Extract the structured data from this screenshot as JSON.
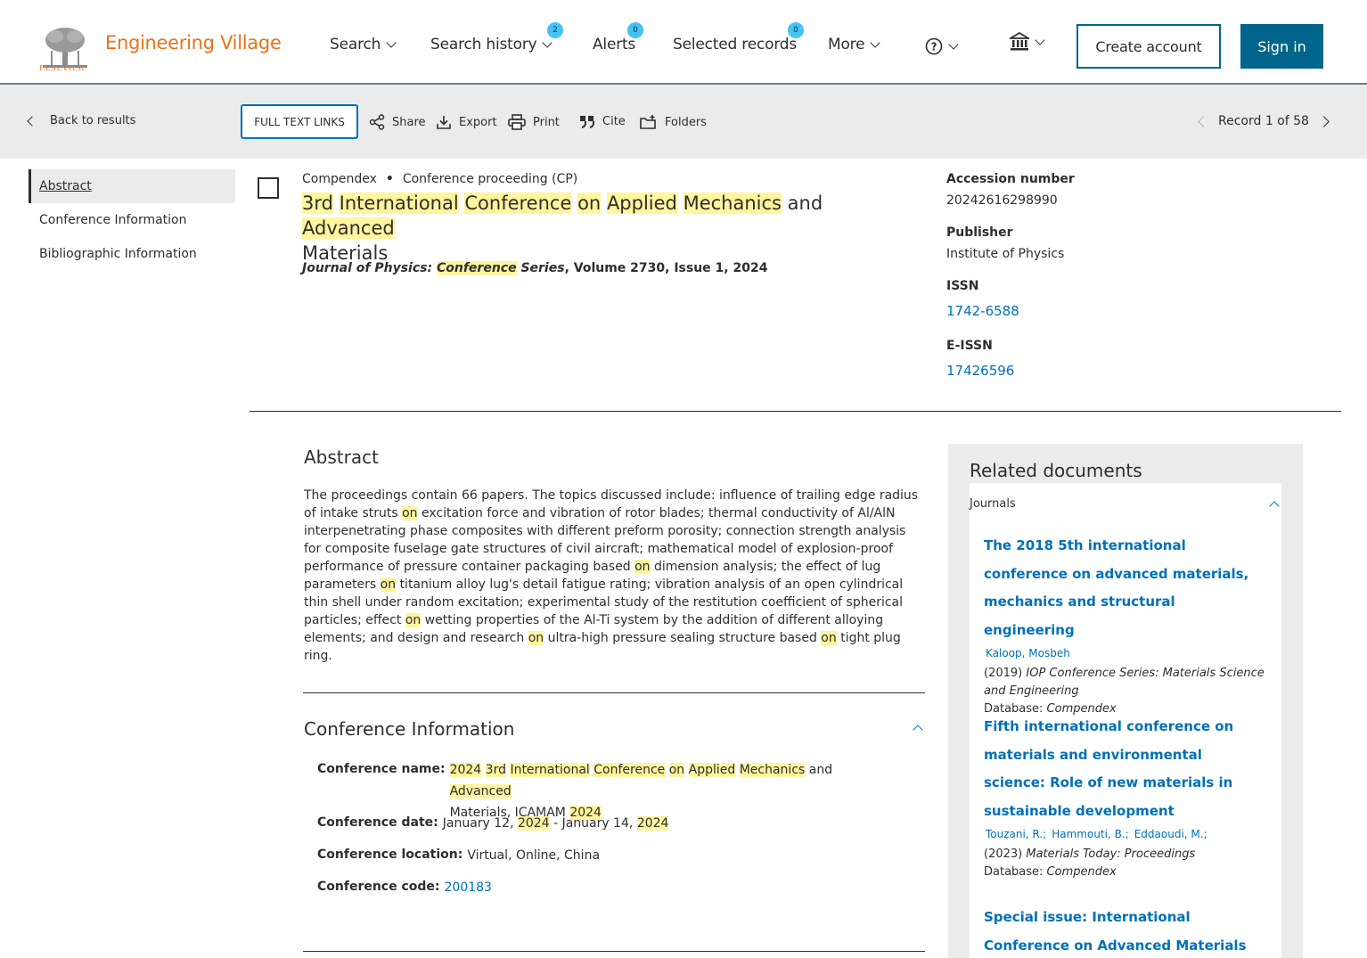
{
  "header": {
    "logo_text": "ELSEVIER",
    "brand": "Engineering Village",
    "nav": {
      "search": "Search",
      "search_history": "Search history",
      "search_history_count": "2",
      "alerts": "Alerts",
      "alerts_count": "0",
      "selected_records": "Selected records",
      "selected_records_count": "0",
      "more": "More"
    },
    "create_account": "Create account",
    "sign_in": "Sign in"
  },
  "toolbar": {
    "back": "Back to results",
    "full_text": "FULL TEXT LINKS",
    "share": "Share",
    "export": "Export",
    "print": "Print",
    "cite": "Cite",
    "folders": "Folders",
    "record_nav": "Record 1 of 58"
  },
  "sidebar": {
    "items": [
      {
        "label": "Abstract"
      },
      {
        "label": "Conference Information"
      },
      {
        "label": "Bibliographic Information"
      }
    ]
  },
  "record": {
    "database": "Compendex",
    "separator": "•",
    "doc_type": "Conference proceeding (CP)",
    "title_words": [
      "3rd",
      "International",
      "Conference",
      "on",
      "Applied",
      "Mechanics",
      "and",
      "Advanced",
      "Materials"
    ],
    "journal_prefix": "Journal of Physics: ",
    "journal_hl": "Conference",
    "journal_suffix": " Series",
    "volume_info": ", Volume 2730, Issue 1, 2024"
  },
  "info": {
    "accession_label": "Accession number",
    "accession_value": "20242616298990",
    "publisher_label": "Publisher",
    "publisher_value": "Institute of Physics",
    "issn_label": "ISSN",
    "issn_value": "1742-6588",
    "eissn_label": "E-ISSN",
    "eissn_value": "17426596"
  },
  "abstract": {
    "heading": "Abstract",
    "parts": [
      "The proceedings contain 66 papers. The topics discussed include: influence of trailing edge radius of intake struts ",
      "on",
      " excitation force and vibration of rotor blades; thermal conductivity of Al/AlN interpenetrating phase composites with different preform porosity; connection strength analysis for composite fuselage gate structures of civil aircraft; mathematical model of explosion-proof performance of pressure container packaging based ",
      "on",
      " dimension analysis; the effect of lug parameters ",
      "on",
      " titanium alloy lug's detail fatigue rating; vibration analysis of an open cylindrical thin shell under random excitation; experimental study of the restitution coefficient of spherical particles; effect ",
      "on",
      " wetting properties of the Al-Ti system by the addition of different alloying elements; and design and research ",
      "on",
      " ultra-high pressure sealing structure based ",
      "on",
      " tight plug ring."
    ]
  },
  "conference": {
    "heading": "Conference Information",
    "name_label": "Conference name:",
    "name_words": [
      "2024",
      "3rd",
      "International",
      "Conference",
      "on",
      "Applied",
      "Mechanics",
      "and",
      "Advanced",
      "Materials, ICAMAM",
      "2024"
    ],
    "date_label": "Conference date:",
    "date_parts": [
      "January 12, ",
      "2024",
      " - January 14, ",
      "2024"
    ],
    "location_label": "Conference location:",
    "location_value": "Virtual, Online, China",
    "code_label": "Conference code:",
    "code_value": "200183"
  },
  "related": {
    "heading": "Related documents",
    "group": "Journals",
    "items": [
      {
        "title": "The 2018 5th international conference on advanced materials, mechanics and structural engineering",
        "authors": [
          "Kaloop, Mosbeh"
        ],
        "year": "(2019)",
        "source": "IOP Conference Series: Materials Science and Engineering",
        "db_label": "Database: ",
        "db": "Compendex"
      },
      {
        "title": "Fifth international conference on materials and environmental science: Role of new materials in sustainable development",
        "authors": [
          "Touzani, R.;",
          "Hammouti, B.;",
          "Eddaoudi, M.;"
        ],
        "year": "(2023)",
        "source": "Materials Today: Proceedings",
        "db_label": "Database: ",
        "db": "Compendex"
      },
      {
        "title": "Special issue: International Conference on Advanced Materials and Mechanical"
      }
    ]
  },
  "colors": {
    "brand_orange": "#e9711c",
    "primary_blue": "#00658a",
    "link_blue": "#0070b8",
    "highlight": "#fff59d",
    "badge": "#44c2f1"
  }
}
